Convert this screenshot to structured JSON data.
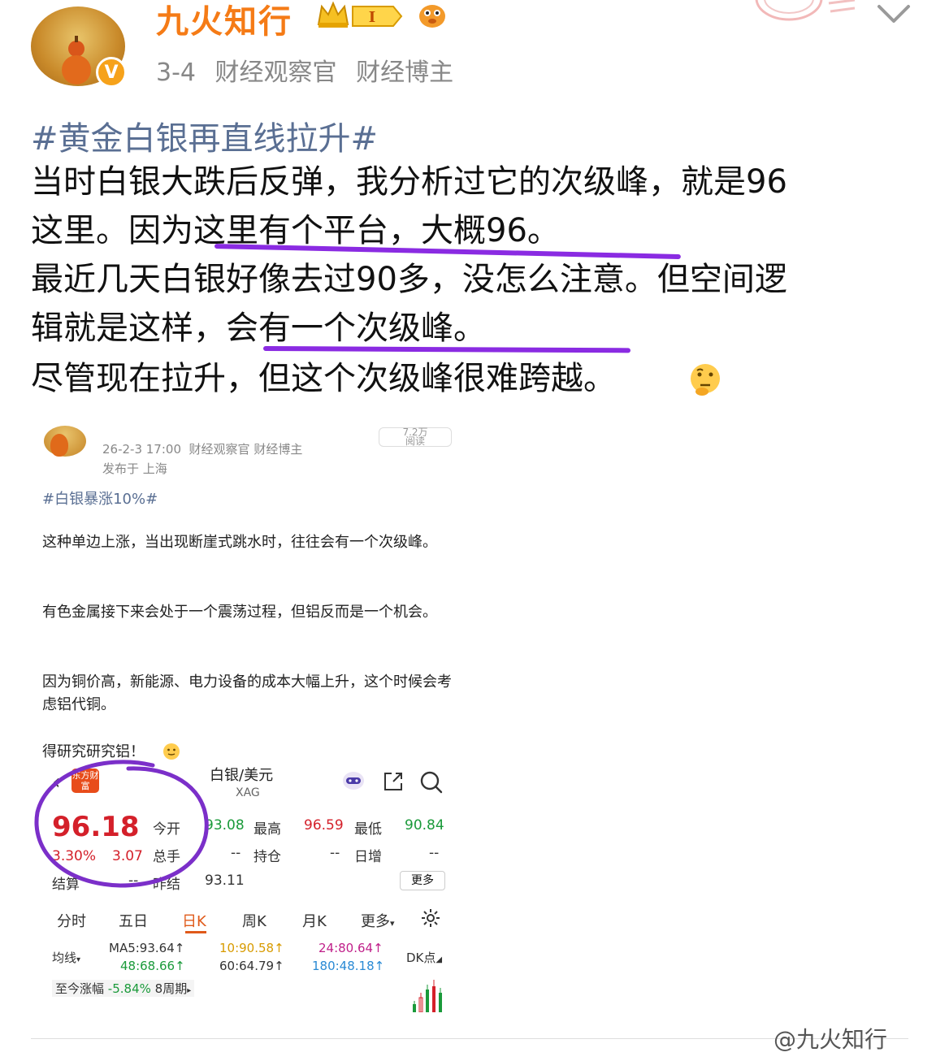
{
  "header": {
    "username": "九火知行",
    "level_badge": "I",
    "date": "3-4",
    "tags": [
      "财经观察官",
      "财经博主"
    ],
    "verify_mark": "V",
    "icons": [
      "crown-icon",
      "level-badge-icon",
      "fish-emoji-icon",
      "chevron-down-icon"
    ]
  },
  "post": {
    "hashtag": "#黄金白银再直线拉升#",
    "lines": [
      "当时白银大跌后反弹，我分析过它的次级峰，就是96",
      "这里。因为这里有个平台，大概96。",
      "最近几天白银好像去过90多，没怎么注意。但空间逻",
      "辑就是这样，会有一个次级峰。",
      "尽管现在拉升，但这个次级峰很难跨越。"
    ],
    "emoji": "thinking-face-icon",
    "underline_color": "#8a2be2"
  },
  "screenshot": {
    "date": "26-2-3 17:00",
    "tags": [
      "财经观察官",
      "财经博主"
    ],
    "location": "发布于 上海",
    "read_count": "7.2万",
    "read_label": "阅读",
    "hashtag": "#白银暴涨10%#",
    "paragraphs": [
      "这种单边上涨，当出现断崖式跳水时，往往会有一个次级峰。",
      "有色金属接下来会处于一个震荡过程，但铝反而是一个机会。",
      "因为铜价高，新能源、电力设备的成本大幅上升，这个时候会考虑铝代铜。",
      "得研究研究铝！"
    ],
    "app_name": "东方财富",
    "quote": {
      "title": "白银/美元",
      "symbol": "XAG",
      "price": "96.18",
      "pct": "3.30%",
      "change": "3.07",
      "open_label": "今开",
      "open": "93.08",
      "high_label": "最高",
      "high": "96.59",
      "low_label": "最低",
      "low": "90.84",
      "volume_label": "总手",
      "volume": "--",
      "position_label": "持仓",
      "position": "--",
      "daily_inc_label": "日增",
      "daily_inc": "--",
      "settle_label": "结算",
      "settle": "--",
      "prev_settle_label": "昨结",
      "prev_settle": "93.11",
      "more": "更多"
    },
    "tabs": [
      "分时",
      "五日",
      "日K",
      "周K",
      "月K",
      "更多"
    ],
    "active_tab": "日K",
    "ma": {
      "label": "均线",
      "ma5": "MA5:93.64↑",
      "ma10": "10:90.58↑",
      "ma24": "24:80.64↑",
      "ma48": "48:68.66↑",
      "ma60": "60:64.79↑",
      "ma180": "180:48.18↑",
      "dk": "DK点"
    },
    "range": {
      "label": "至今涨幅",
      "value": "-5.84%",
      "period": "8周期"
    },
    "circle_color": "#7b2fc9"
  },
  "watermark": "@九火知行"
}
